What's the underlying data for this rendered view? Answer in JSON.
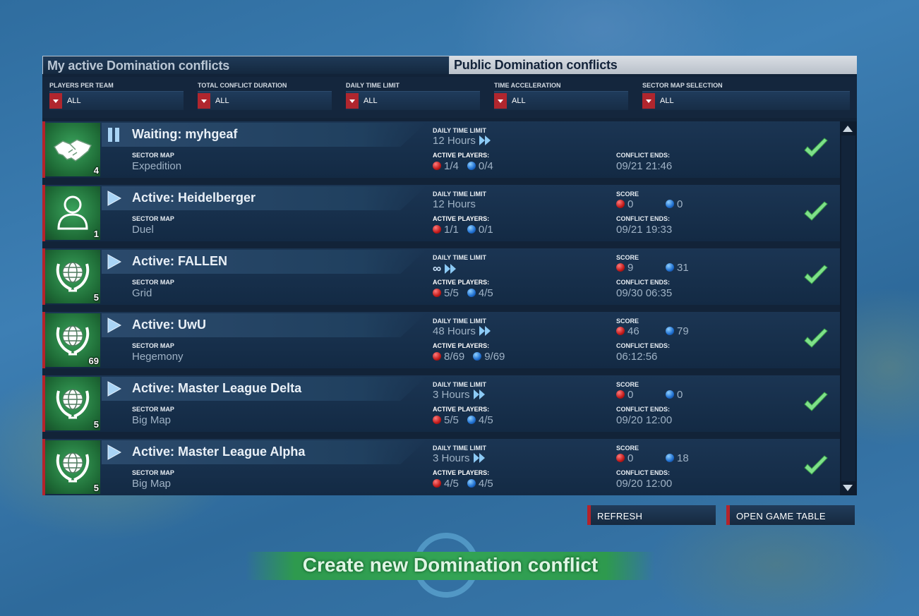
{
  "tabs": {
    "my_active": "My active Domination conflicts",
    "public": "Public Domination conflicts"
  },
  "filters": [
    {
      "label": "PLAYERS PER TEAM",
      "value": "ALL"
    },
    {
      "label": "TOTAL CONFLICT DURATION",
      "value": "ALL"
    },
    {
      "label": "DAILY TIME LIMIT",
      "value": "ALL"
    },
    {
      "label": "TIME ACCELERATION",
      "value": "ALL"
    },
    {
      "label": "SECTOR MAP SELECTION",
      "value": "ALL"
    }
  ],
  "labels": {
    "sector_map": "SECTOR MAP",
    "daily_time_limit": "DAILY TIME LIMIT",
    "active_players": "ACTIVE PLAYERS:",
    "score": "SCORE",
    "conflict_ends": "CONFLICT ENDS:"
  },
  "conflicts": [
    {
      "status": "paused",
      "icon": "handshake-icon",
      "team_size": "4",
      "title": "Waiting: myhgeaf",
      "sector_map": "Expedition",
      "daily_limit": "12 Hours",
      "accelerated": true,
      "players_red": "1/4",
      "players_blue": "0/4",
      "score_red": "",
      "score_blue": "",
      "ends": "09/21 21:46"
    },
    {
      "status": "active",
      "icon": "person-icon",
      "team_size": "1",
      "title": "Active: Heidelberger",
      "sector_map": "Duel",
      "daily_limit": "12 Hours",
      "accelerated": false,
      "players_red": "1/1",
      "players_blue": "0/1",
      "score_red": "0",
      "score_blue": "0",
      "ends": "09/21 19:33"
    },
    {
      "status": "active",
      "icon": "globe-laurel-icon",
      "team_size": "5",
      "title": "Active: FALLEN",
      "sector_map": "Grid",
      "daily_limit": "∞",
      "accelerated": true,
      "players_red": "5/5",
      "players_blue": "4/5",
      "score_red": "9",
      "score_blue": "31",
      "ends": "09/30 06:35"
    },
    {
      "status": "active",
      "icon": "globe-laurel-icon",
      "team_size": "69",
      "title": "Active: UwU",
      "sector_map": "Hegemony",
      "daily_limit": "48 Hours",
      "accelerated": true,
      "players_red": "8/69",
      "players_blue": "9/69",
      "score_red": "46",
      "score_blue": "79",
      "ends": "06:12:56"
    },
    {
      "status": "active",
      "icon": "globe-laurel-icon",
      "team_size": "5",
      "title": "Active: Master League Delta",
      "sector_map": "Big Map",
      "daily_limit": "3 Hours",
      "accelerated": true,
      "players_red": "5/5",
      "players_blue": "4/5",
      "score_red": "0",
      "score_blue": "0",
      "ends": "09/20 12:00"
    },
    {
      "status": "active",
      "icon": "globe-laurel-icon",
      "team_size": "5",
      "title": "Active: Master League Alpha",
      "sector_map": "Big Map",
      "daily_limit": "3 Hours",
      "accelerated": true,
      "players_red": "4/5",
      "players_blue": "4/5",
      "score_red": "0",
      "score_blue": "18",
      "ends": "09/20 12:00"
    }
  ],
  "buttons": {
    "refresh": "REFRESH",
    "open_game_table": "OPEN GAME TABLE",
    "create": "Create new Domination conflict"
  },
  "colors": {
    "accent_red": "#b4232b",
    "check_green": "#7fe08a",
    "panel_bg": "#122338"
  }
}
